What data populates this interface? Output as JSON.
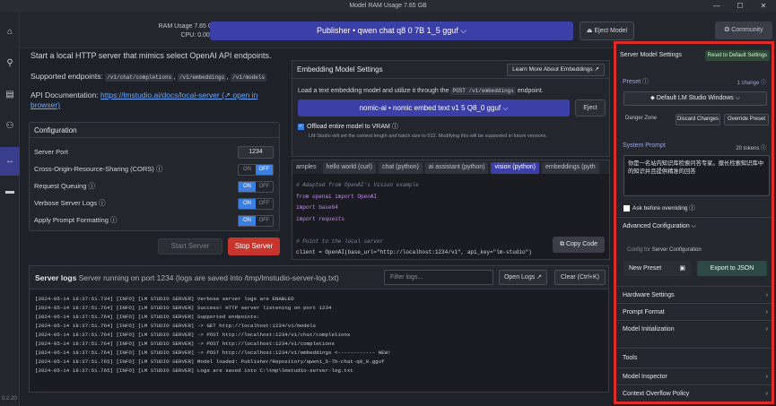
{
  "window": {
    "title": "Model RAM Usage  7.65 GB",
    "min": "—",
    "max": "☐",
    "close": "✕"
  },
  "topbar": {
    "ram_label": "RAM Usage",
    "ram_value": "7.65 GB",
    "cpu_label": "CPU:",
    "cpu_value": "0.00 %",
    "model_selector": "Publisher • qwen chat q8 0 7B 1_5 gguf ⌵",
    "eject_label": "Eject Model",
    "community_label": "Community"
  },
  "sidebar": {
    "version": "0.2.20"
  },
  "server": {
    "intro": "Start a local HTTP server that mimics select OpenAI API endpoints.",
    "endpoints_label": "Supported endpoints:",
    "endpoints": [
      "/v1/chat/completions",
      "/v1/embeddings",
      "/v1/models"
    ],
    "api_doc_label": "API Documentation:",
    "api_doc_link": "https://lmstudio.ai/docs/local-server (↗ open in browser)",
    "config_title": "Configuration",
    "port_label": "Server Port",
    "port_value": "1234",
    "cors_label": "Cross-Origin-Resource-Sharing (CORS) ⓘ",
    "queue_label": "Request Queuing ⓘ",
    "verbose_label": "Verbose Server Logs ⓘ",
    "format_label": "Apply Prompt Formatting ⓘ",
    "on": "ON",
    "off": "OFF",
    "start_label": "Start Server",
    "stop_label": "Stop Server"
  },
  "embedding": {
    "title": "Embedding Model Settings",
    "learn": "Learn More About Embeddings ↗",
    "desc_a": "Load a text embedding model and utilize it through the",
    "desc_code": "POST /v1/embeddings",
    "desc_b": "endpoint.",
    "model": "nomic-ai • nomic embed text v1 5 Q8_0 gguf ⌵",
    "eject": "Eject",
    "offload": "Offload entire model to VRAM ⓘ",
    "note": "LM Studio will set the context length and batch size to 512. Modifying this will be supported in future versions."
  },
  "snippets": {
    "tabs": [
      "amples",
      "hello world (curl)",
      "chat (python)",
      "ai assistant (python)",
      "vision (python)",
      "embeddings (pyth"
    ],
    "code": [
      "# Adapted from OpenAI's Vision example",
      "from openai import OpenAI",
      "import base64",
      "import requests",
      "",
      "# Point to the local server",
      "client = OpenAI(base_url=\"http://localhost:1234/v1\", api_key=\"lm-studio\")"
    ],
    "copy": "Copy Code"
  },
  "logs": {
    "title": "Server logs",
    "subtitle": "Server running on port 1234 (logs are saved into /tmp/lmstudio-server-log.txt)",
    "filter_placeholder": "Filter logs...",
    "open": "Open Logs ↗",
    "clear": "Clear (Ctrl+K)",
    "lines": [
      "[2024-05-14 18:37:51.734] [INFO] [LM STUDIO SERVER] Verbose server logs are ENABLED",
      "[2024-05-14 18:37:51.764] [INFO] [LM STUDIO SERVER] Success! HTTP server listening on port 1234",
      "[2024-05-14 18:37:51.764] [INFO] [LM STUDIO SERVER] Supported endpoints:",
      "[2024-05-14 18:37:51.764] [INFO] [LM STUDIO SERVER] ->   GET  http://localhost:1234/v1/models",
      "[2024-05-14 18:37:51.764] [INFO] [LM STUDIO SERVER] ->   POST http://localhost:1234/v1/chat/completions",
      "[2024-05-14 18:37:51.764] [INFO] [LM STUDIO SERVER] ->   POST http://localhost:1234/v1/completions",
      "[2024-05-14 18:37:51.764] [INFO] [LM STUDIO SERVER] ->   POST http://localhost:1234/v1/embeddings      <------------ NEW!",
      "[2024-05-14 18:37:51.765] [INFO] [LM STUDIO SERVER] Model loaded: Publisher/Repository/qwen1_5-7b-chat-q8_0.gguf",
      "[2024-05-14 18:37:51.765] [INFO] [LM STUDIO SERVER] Logs are saved into C:\\tmp\\lmstudio-server-log.txt"
    ]
  },
  "right": {
    "title": "Server Model Settings",
    "reset": "Reset to Default Settings",
    "preset_label": "Preset ⓘ",
    "preset_change": "1 change ⓘ",
    "preset_value": "Default LM Studio Windows ⌵",
    "danger": "Danger Zone",
    "discard": "Discard Changes",
    "override": "Override Preset",
    "sys_label": "System Prompt",
    "tokens": "20 tokens ⓘ",
    "sys_text": "你是一名站内知识库检索问答专家。擅长检索知识库中的知识并且提供精准的回答",
    "ask": "Ask before overriding ⓘ",
    "adv": "Advanced Configuration ⌵",
    "cfgfor_a": "Config for",
    "cfgfor_b": "Server Configuration",
    "newpreset": "New Preset",
    "export": "Export to JSON",
    "hw": "Hardware Settings",
    "pf": "Prompt Format",
    "mi": "Model Initialization",
    "tools": "Tools",
    "insp": "Model Inspector",
    "ctx": "Context Overflow Policy",
    "chevron": "›"
  }
}
